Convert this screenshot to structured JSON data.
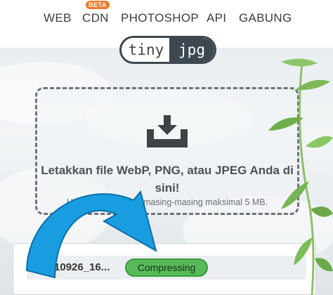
{
  "nav": {
    "items": [
      "WEB",
      "CDN",
      "PHOTOSHOP",
      "API",
      "GABUNG"
    ],
    "beta_badge": "BETA"
  },
  "logo": {
    "left": "tiny",
    "right": "jpg"
  },
  "dropzone": {
    "title": "Letakkan file WebP, PNG, atau JPEG Anda di sini!",
    "subtitle": "Hingga 20 gambar, masing-masing maksimal 5 MB."
  },
  "upload": {
    "file_name": "20210926_16...",
    "status": "Compressing"
  },
  "colors": {
    "status_green": "#58b958",
    "arrow_blue": "#1a9de0",
    "beta_orange": "#ef7a2c",
    "logo_dark": "#3e4850"
  },
  "icons": [
    "download-tray-icon",
    "curved-arrow-annotation"
  ]
}
